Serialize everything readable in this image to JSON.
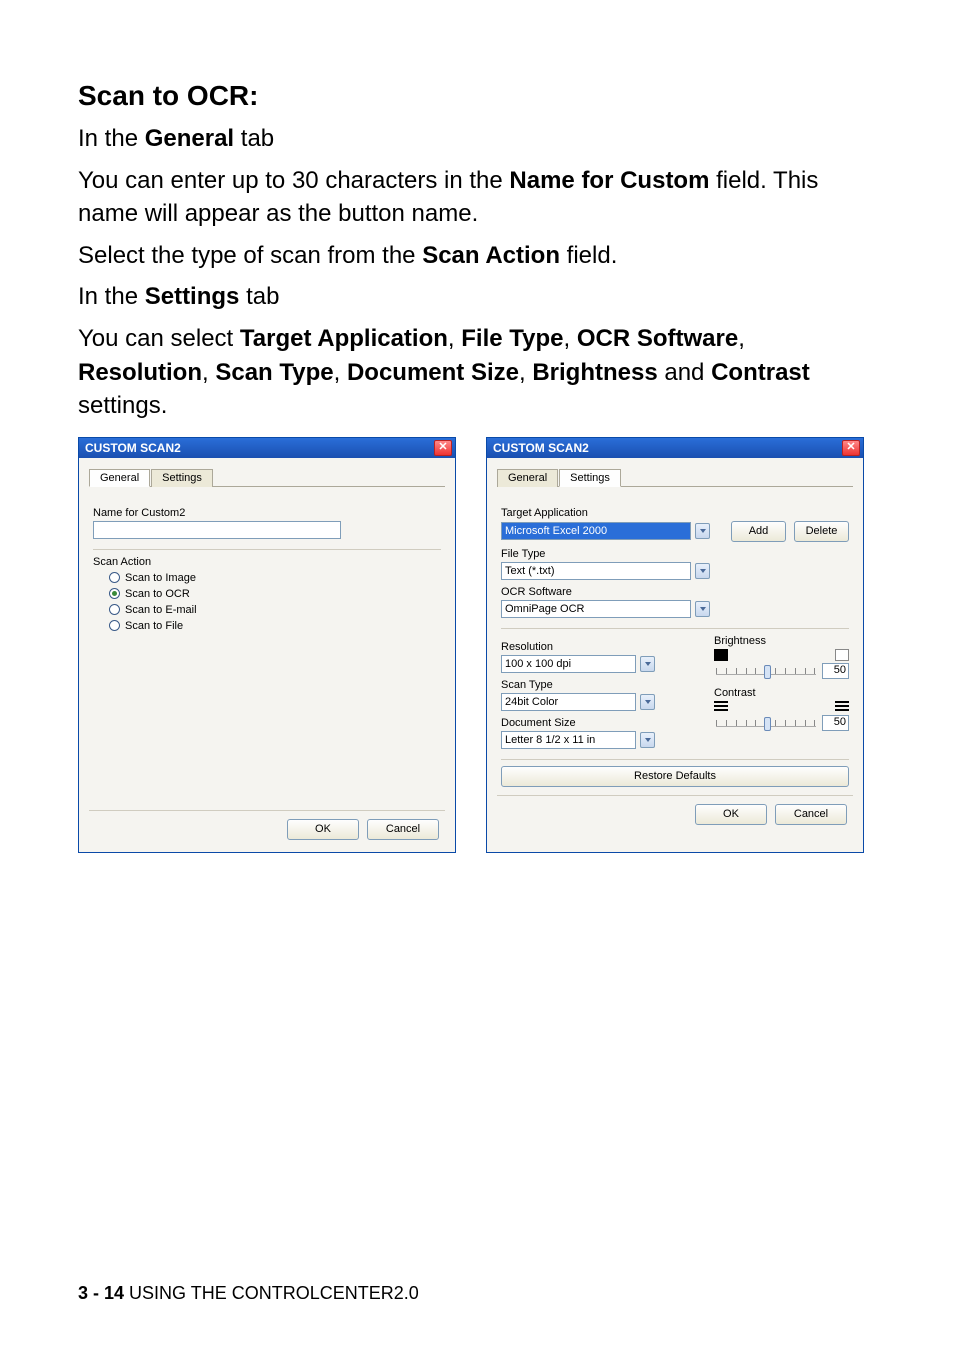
{
  "heading": "Scan to OCR:",
  "paragraphs": {
    "p1_pre": "In the ",
    "p1_b": "General",
    "p1_post": " tab",
    "p2_pre": "You can enter up to 30 characters in the ",
    "p2_b": "Name for Custom",
    "p2_post": " field. This name will appear as the button name.",
    "p3_pre": "Select the type of scan from the ",
    "p3_b": "Scan Action",
    "p3_post": " field.",
    "p4_pre": "In the ",
    "p4_b": "Settings",
    "p4_post": " tab",
    "p5_pre": "You can select ",
    "p5_b1": "Target Application",
    "p5_s1": ", ",
    "p5_b2": "File Type",
    "p5_s2": ", ",
    "p5_b3": "OCR Software",
    "p5_s3": ", ",
    "p5_b4": "Resolution",
    "p5_s4": ", ",
    "p5_b5": "Scan Type",
    "p5_s5": ", ",
    "p5_b6": "Document Size",
    "p5_s6": ", ",
    "p5_b7": "Brightness",
    "p5_s7": " and ",
    "p5_b8": "Contrast",
    "p5_post": " settings."
  },
  "dialog1": {
    "title": "CUSTOM SCAN2",
    "tabs": {
      "general": "General",
      "settings": "Settings"
    },
    "name_label": "Name for Custom2",
    "name_value": "",
    "scan_action_label": "Scan Action",
    "radios": {
      "image": "Scan to Image",
      "ocr": "Scan to OCR",
      "email": "Scan to E-mail",
      "file": "Scan to File"
    },
    "ok": "OK",
    "cancel": "Cancel"
  },
  "dialog2": {
    "title": "CUSTOM SCAN2",
    "tabs": {
      "general": "General",
      "settings": "Settings"
    },
    "target_label": "Target Application",
    "target_value": "Microsoft Excel 2000",
    "add": "Add",
    "delete": "Delete",
    "filetype_label": "File Type",
    "filetype_value": "Text (*.txt)",
    "ocr_label": "OCR Software",
    "ocr_value": "OmniPage OCR",
    "res_label": "Resolution",
    "res_value": "100 x 100 dpi",
    "scantype_label": "Scan Type",
    "scantype_value": "24bit Color",
    "docsize_label": "Document Size",
    "docsize_value": "Letter 8 1/2 x 11 in",
    "brightness_label": "Brightness",
    "brightness_value": "50",
    "contrast_label": "Contrast",
    "contrast_value": "50",
    "restore": "Restore Defaults",
    "ok": "OK",
    "cancel": "Cancel"
  },
  "footer": {
    "page": "3 - 14",
    "section": "   USING THE CONTROLCENTER2.0"
  }
}
